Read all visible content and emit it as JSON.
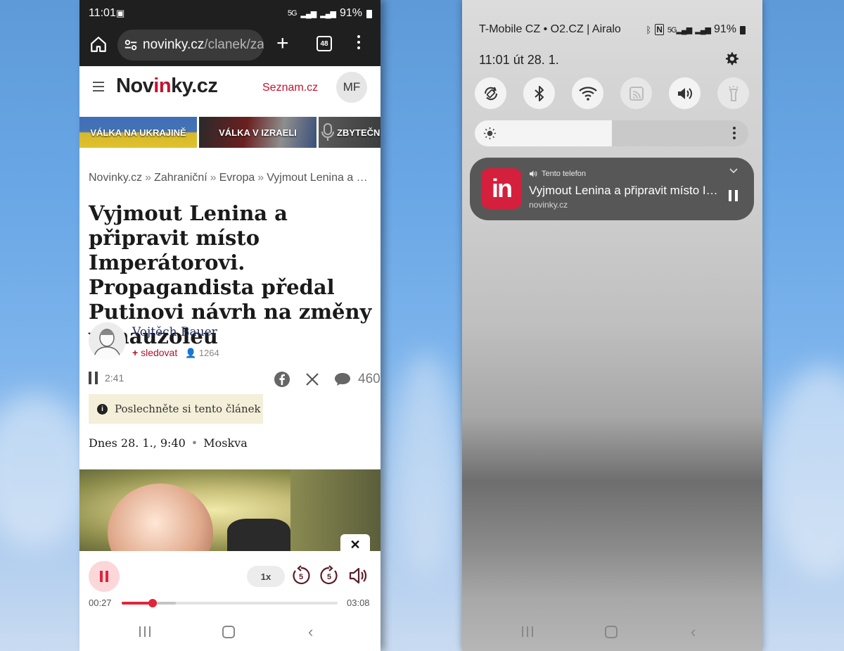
{
  "left_phone": {
    "status": {
      "time": "11:01",
      "network": "5G",
      "battery": "91%"
    },
    "browser": {
      "url_host": "novinky.cz",
      "url_path": "/clanek/zal",
      "tab_count": "48"
    },
    "site": {
      "logo_pre": "Nov",
      "logo_accent": "in",
      "logo_post": "ky.cz",
      "seznam_link": "Seznam.cz",
      "avatar_initials": "MF"
    },
    "topics": [
      "VÁLKA NA UKRAJINĚ",
      "VÁLKA V IZRAELI",
      "ZBYTEČNÁ"
    ],
    "breadcrumb": [
      "Novinky.cz",
      "Zahraniční",
      "Evropa",
      "Vyjmout Lenina a připravit místo Imperátorovi"
    ],
    "article": {
      "title": "Vyjmout Lenina a připravit místo Imperátorovi. Propagandista předal Putinovi návrh na změny v mauzoleu",
      "author": "Vojtěch Bauer",
      "follow_label": "sledovat",
      "followers": "1264",
      "audio_duration": "2:41",
      "comments": "460",
      "listen_tip": "Poslechněte si tento článek",
      "date": "Dnes 28. 1., 9:40",
      "location": "Moskva"
    },
    "player": {
      "speed": "1x",
      "skip_back": "5",
      "skip_forward": "5",
      "elapsed": "00:27",
      "total": "03:08",
      "progress": 0.144,
      "buffered": 0.25
    }
  },
  "right_phone": {
    "status": {
      "carriers": "T-Mobile CZ • O2.CZ | Airalo",
      "battery": "91%"
    },
    "datetime": "11:01  út 28. 1.",
    "brightness": 0.5,
    "media": {
      "app_label": "in",
      "source": "Tento telefon",
      "title": "Vyjmout Lenina a připravit místo Imperátorovi",
      "site": "novinky.cz"
    }
  },
  "colors": {
    "brand_red": "#c8102e",
    "player_red": "#e0243a",
    "notif_card": "#575757"
  }
}
